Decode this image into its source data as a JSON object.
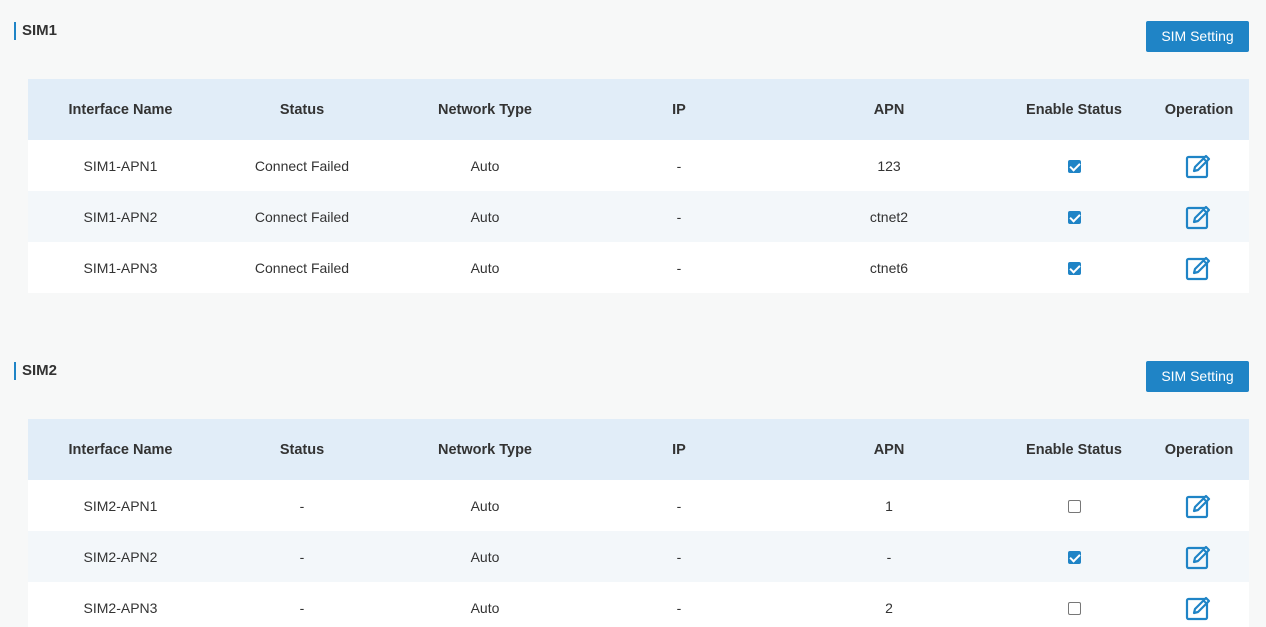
{
  "colors": {
    "accent": "#1f84c6",
    "failed": "#e03b3b",
    "header_bg": "#e1edf8"
  },
  "sections": [
    {
      "title": "SIM1",
      "button_label": "SIM Setting",
      "headers": [
        "Interface Name",
        "Status",
        "Network Type",
        "IP",
        "APN",
        "Enable Status",
        "Operation"
      ],
      "rows": [
        {
          "interface": "SIM1-APN1",
          "status": "Connect Failed",
          "network_type": "Auto",
          "ip": "-",
          "apn": "123",
          "enabled": true
        },
        {
          "interface": "SIM1-APN2",
          "status": "Connect Failed",
          "network_type": "Auto",
          "ip": "-",
          "apn": "ctnet2",
          "enabled": true
        },
        {
          "interface": "SIM1-APN3",
          "status": "Connect Failed",
          "network_type": "Auto",
          "ip": "-",
          "apn": "ctnet6",
          "enabled": true
        }
      ]
    },
    {
      "title": "SIM2",
      "button_label": "SIM Setting",
      "headers": [
        "Interface Name",
        "Status",
        "Network Type",
        "IP",
        "APN",
        "Enable Status",
        "Operation"
      ],
      "rows": [
        {
          "interface": "SIM2-APN1",
          "status": "-",
          "network_type": "Auto",
          "ip": "-",
          "apn": "1",
          "enabled": false
        },
        {
          "interface": "SIM2-APN2",
          "status": "-",
          "network_type": "Auto",
          "ip": "-",
          "apn": "-",
          "enabled": true
        },
        {
          "interface": "SIM2-APN3",
          "status": "-",
          "network_type": "Auto",
          "ip": "-",
          "apn": "2",
          "enabled": false
        }
      ]
    }
  ],
  "icons": {
    "edit": "edit-icon",
    "checkbox": "checkbox"
  }
}
